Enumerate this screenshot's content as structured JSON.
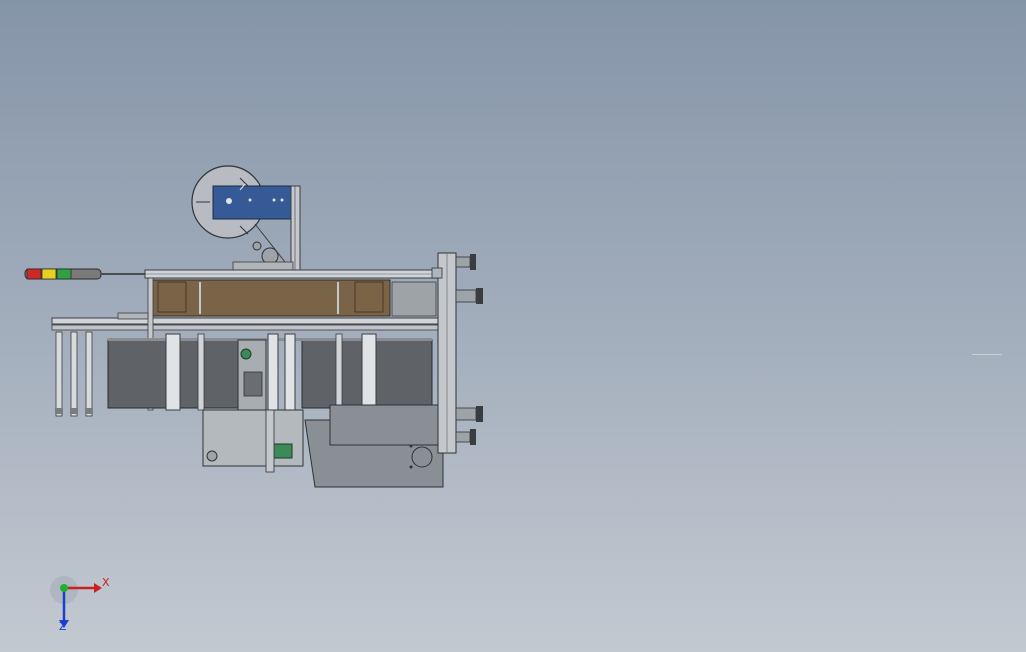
{
  "viewport": {
    "background_top": "#8595a8",
    "background_bottom": "#c3c9d1"
  },
  "model": {
    "description_icon": "labeling-machine-assembly-icon",
    "colors": {
      "frame": "#c4c8cc",
      "frame_edge": "#3a3d40",
      "label_plate": "#355a96",
      "brown_panel": "#7a6448",
      "belt": "#5f6266",
      "base": "#8a8f96",
      "green_part": "#3c8a58"
    },
    "signal_tower_colors": [
      "#d02828",
      "#e8d020",
      "#30a040",
      "#7a7a7a"
    ]
  },
  "triad": {
    "x_label": "X",
    "z_label": "Z",
    "x_color": "#cc2020",
    "y_color": "#20b030",
    "z_color": "#1a3fd0"
  }
}
